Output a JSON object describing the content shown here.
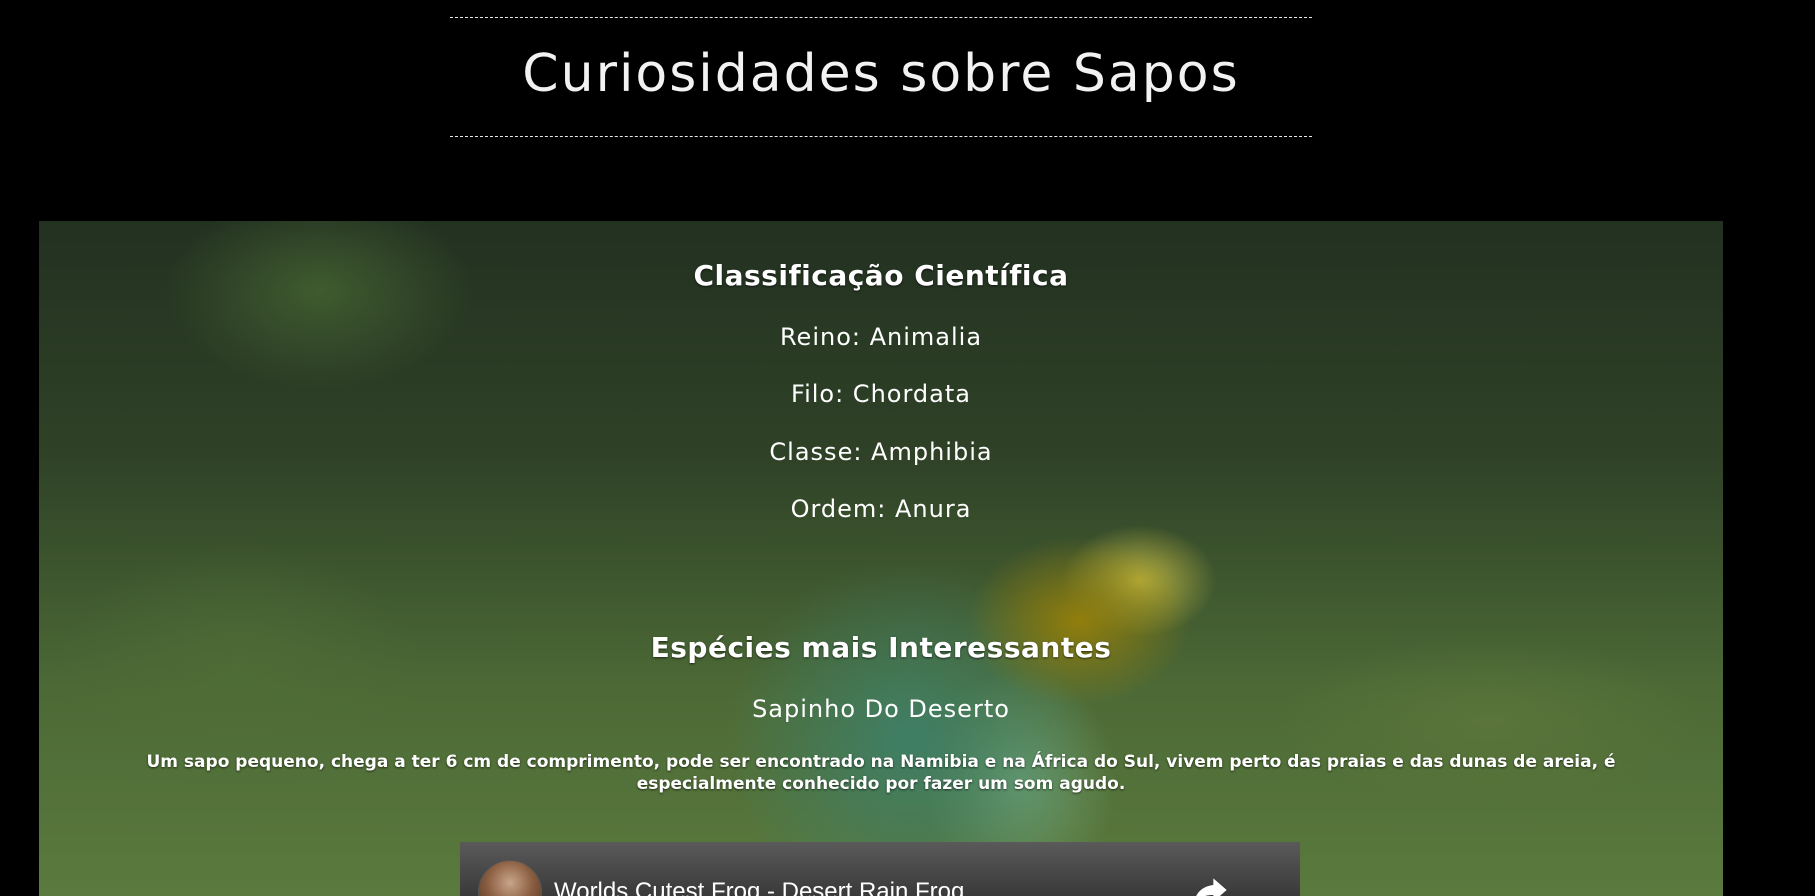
{
  "header": {
    "title": "Curiosidades sobre Sapos"
  },
  "classification": {
    "heading": "Classificação Científica",
    "lines": [
      "Reino: Animalia",
      "Filo: Chordata",
      "Classe: Amphibia",
      "Ordem: Anura"
    ]
  },
  "species": {
    "heading": "Espécies mais Interessantes",
    "name": "Sapinho Do Deserto",
    "description": "Um sapo pequeno, chega a ter 6 cm de comprimento, pode ser encontrado na Namibia e na África do Sul, vivem perto das praias e das dunas de areia, é especialmente conhecido por fazer um som agudo."
  },
  "video": {
    "title": "Worlds Cutest Frog - Desert Rain Frog",
    "share_icon": "share-icon",
    "avatar_icon": "avatar"
  },
  "colors": {
    "background": "#000000",
    "text": "#ffffff"
  }
}
